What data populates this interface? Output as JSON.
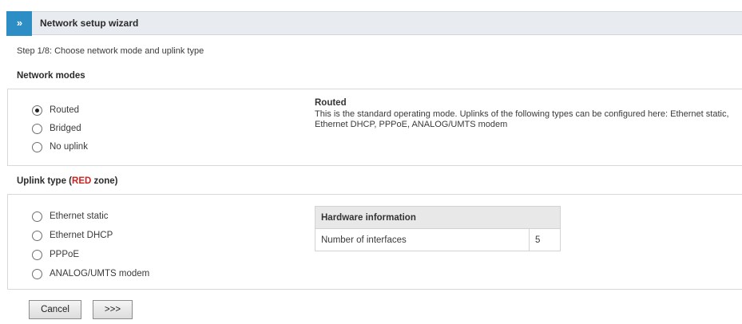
{
  "wizard": {
    "expand_glyph": "»",
    "title": "Network setup wizard",
    "step": "Step 1/8: Choose network mode and uplink type"
  },
  "network_modes": {
    "heading": "Network modes",
    "options": [
      {
        "label": "Routed",
        "selected": true
      },
      {
        "label": "Bridged",
        "selected": false
      },
      {
        "label": "No uplink",
        "selected": false
      }
    ],
    "description_title": "Routed",
    "description_text": "This is the standard operating mode. Uplinks of the following types can be configured here: Ethernet static, Ethernet DHCP, PPPoE, ANALOG/UMTS modem"
  },
  "uplink_type": {
    "heading_prefix": "Uplink type (",
    "heading_zone": "RED",
    "heading_suffix": " zone)",
    "zone_color": "#cc2222",
    "options": [
      {
        "label": "Ethernet static",
        "selected": false
      },
      {
        "label": "Ethernet DHCP",
        "selected": false
      },
      {
        "label": "PPPoE",
        "selected": false
      },
      {
        "label": "ANALOG/UMTS modem",
        "selected": false
      }
    ]
  },
  "hardware_info": {
    "header": "Hardware information",
    "rows": [
      {
        "label": "Number of interfaces",
        "value": "5"
      }
    ]
  },
  "buttons": {
    "cancel": "Cancel",
    "next": ">>>"
  },
  "colors": {
    "accent": "#2d8ec6",
    "titlebar_bg": "#e8ecf1"
  }
}
